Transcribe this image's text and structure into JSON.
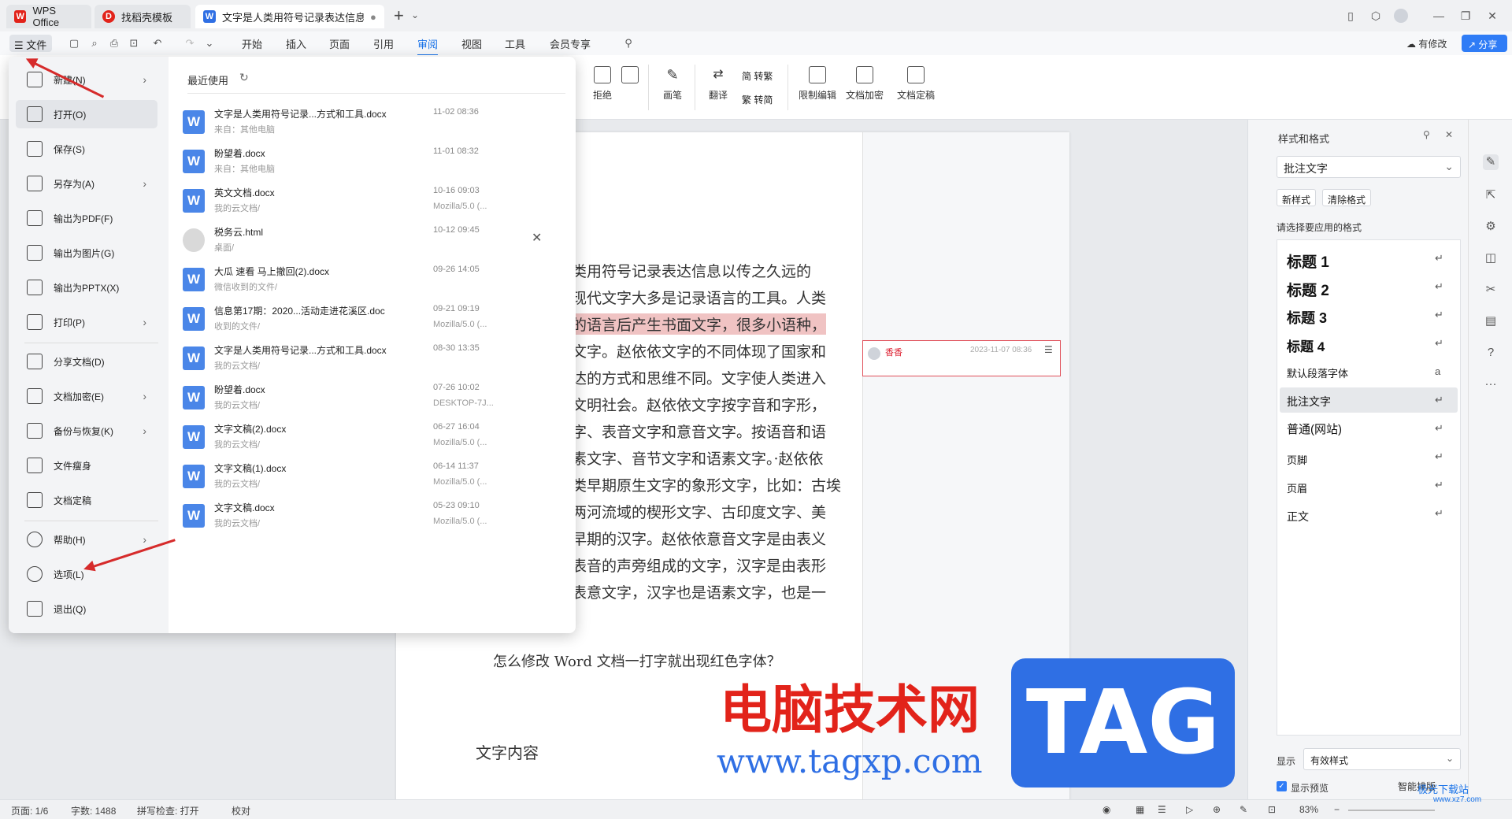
{
  "titlebar": {
    "tabs": [
      {
        "label": "WPS Office"
      },
      {
        "label": "找稻壳模板"
      },
      {
        "label": "文字是人类用符号记录表达信息以"
      }
    ],
    "new_tab": "+"
  },
  "menubar": {
    "file_label": "文件",
    "tabs": [
      "开始",
      "插入",
      "页面",
      "引用",
      "审阅",
      "视图",
      "工具",
      "会员专享"
    ],
    "active_tab": "审阅",
    "changes_label": "有修改",
    "share_label": "分享"
  },
  "ribbon": {
    "reject_label": "拒绝",
    "pen_label": "画笔",
    "translate_label": "翻译",
    "to_traditional_label": "简 转繁",
    "to_simplified_label": "繁 转简",
    "restrict_edit_label": "限制编辑",
    "encrypt_label": "文档加密",
    "finalize_label": "文档定稿"
  },
  "file_menu": {
    "items": [
      {
        "label": "新建(N)",
        "arrow": true
      },
      {
        "label": "打开(O)",
        "arrow": false
      },
      {
        "label": "保存(S)",
        "arrow": false
      },
      {
        "label": "另存为(A)",
        "arrow": true
      },
      {
        "label": "输出为PDF(F)",
        "arrow": false
      },
      {
        "label": "输出为图片(G)",
        "arrow": false
      },
      {
        "label": "输出为PPTX(X)",
        "arrow": false
      },
      {
        "label": "打印(P)",
        "arrow": true
      },
      {
        "label": "分享文档(D)",
        "arrow": false
      },
      {
        "label": "文档加密(E)",
        "arrow": true
      },
      {
        "label": "备份与恢复(K)",
        "arrow": true
      },
      {
        "label": "文件瘦身",
        "arrow": false
      },
      {
        "label": "文档定稿",
        "arrow": false
      },
      {
        "label": "帮助(H)",
        "arrow": true
      },
      {
        "label": "选项(L)",
        "arrow": false
      },
      {
        "label": "退出(Q)",
        "arrow": false
      }
    ],
    "recent_title": "最近使用",
    "recent": [
      {
        "name": "文字是人类用符号记录...方式和工具.docx",
        "sub": "来自：其他电脑",
        "date": "11-02 08:36",
        "src": ""
      },
      {
        "name": "盼望着.docx",
        "sub": "来自：其他电脑",
        "date": "11-01 08:32",
        "src": ""
      },
      {
        "name": "英文文档.docx",
        "sub": "我的云文档/",
        "date": "10-16 09:03",
        "src": "Mozilla/5.0 (..."
      },
      {
        "name": "税务云.html",
        "sub": "桌面/",
        "date": "10-12 09:45",
        "src": ""
      },
      {
        "name": "大瓜 速看 马上撤回(2).docx",
        "sub": "微信收到的文件/",
        "date": "09-26 14:05",
        "src": ""
      },
      {
        "name": "信息第17期：2020...活动走进花溪区.doc",
        "sub": "收到的文件/",
        "date": "09-21 09:19",
        "src": "Mozilla/5.0 (..."
      },
      {
        "name": "文字是人类用符号记录...方式和工具.docx",
        "sub": "我的云文档/",
        "date": "08-30 13:35",
        "src": ""
      },
      {
        "name": "盼望着.docx",
        "sub": "我的云文档/",
        "date": "07-26 10:02",
        "src": "DESKTOP-7J..."
      },
      {
        "name": "文字文稿(2).docx",
        "sub": "我的云文档/",
        "date": "06-27 16:04",
        "src": "Mozilla/5.0 (..."
      },
      {
        "name": "文字文稿(1).docx",
        "sub": "我的云文档/",
        "date": "06-14 11:37",
        "src": "Mozilla/5.0 (..."
      },
      {
        "name": "文字文稿.docx",
        "sub": "我的云文档/",
        "date": "05-23 09:10",
        "src": "Mozilla/5.0 (..."
      }
    ]
  },
  "document": {
    "lines": [
      {
        "text": "类用符号记录表达信息以传之久远的"
      },
      {
        "text": "现代文字大多是记录语言的工具。人类"
      },
      {
        "text": "的语言后产生书面文字，很多小语种，"
      },
      {
        "text": "文字。赵依依文字的不同体现了国家和"
      },
      {
        "text": "达的方式和思维不同。文字使人类进入"
      },
      {
        "text": "文明社会。赵依依文字按字音和字形，"
      },
      {
        "text": "字、表音文字和意音文字。按语音和语"
      },
      {
        "text": "素文字、音节文字和语素文字。·赵依依"
      },
      {
        "text": "类早期原生文字的象形文字，比如：古埃"
      },
      {
        "text": "两河流域的楔形文字、古印度文字、美"
      },
      {
        "text": "早期的汉字。赵依依意音文字是由表义"
      },
      {
        "text": "表音的声旁组成的文字，汉字是由表形"
      },
      {
        "text": "表意文字，汉字也是语素文字，也是一"
      }
    ],
    "question": "怎么修改 Word 文档一打字就出现红色字体？",
    "content_label": "文字内容",
    "comment_author": "香香",
    "comment_time": "2023-11-07 08:36"
  },
  "styles_panel": {
    "title": "样式和格式",
    "current_style": "批注文字",
    "new_style": "新样式",
    "clear_format": "清除格式",
    "prompt": "请选择要应用的格式",
    "styles": [
      {
        "label": "标题  1"
      },
      {
        "label": "标题  2"
      },
      {
        "label": "标题  3"
      },
      {
        "label": "标题  4"
      },
      {
        "label": "默认段落字体"
      },
      {
        "label": "批注文字"
      },
      {
        "label": "普通(网站)"
      },
      {
        "label": "页脚"
      },
      {
        "label": "页眉"
      },
      {
        "label": "正文"
      }
    ],
    "show_label": "显示",
    "show_value": "有效样式",
    "preview_label": "显示预览",
    "smart_label": "智能排版"
  },
  "statusbar": {
    "page": "页面: 1/6",
    "words": "字数: 1488",
    "spell": "拼写检查: 打开",
    "proof": "校对",
    "zoom": "83%"
  },
  "watermark": {
    "site_cn": "电脑技术网",
    "site_url": "www.tagxp.com",
    "tag": "TAG",
    "corner": "极光下载站",
    "corner_url": "www.xz7.com"
  }
}
